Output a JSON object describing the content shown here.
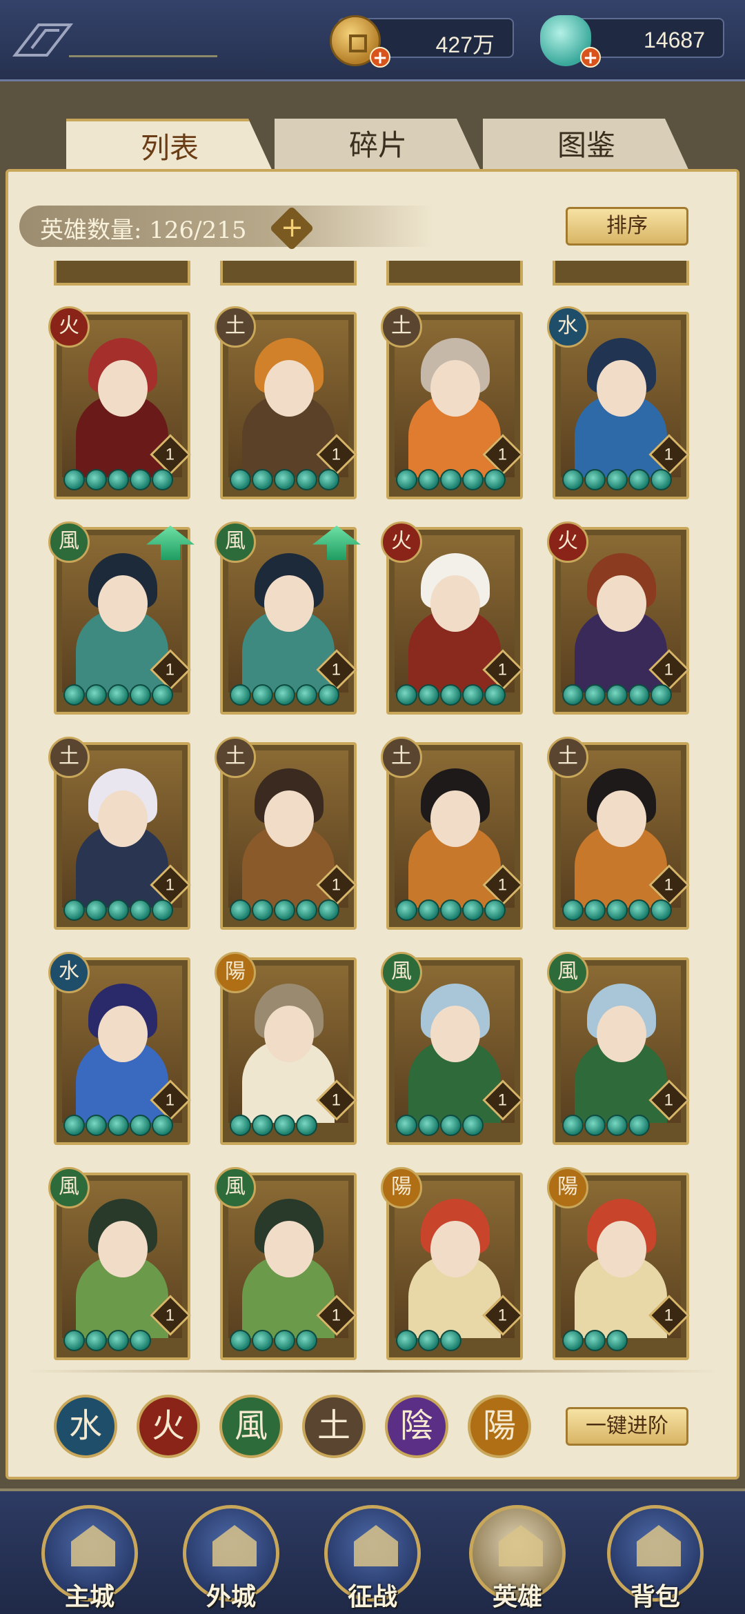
{
  "currency": {
    "coins_value": "427万",
    "gems_value": "14687",
    "coin_icon": "copper-coin-icon",
    "gem_icon": "jade-shell-icon"
  },
  "tabs": [
    {
      "label": "列表",
      "active": true
    },
    {
      "label": "碎片",
      "active": false
    },
    {
      "label": "图鉴",
      "active": false
    }
  ],
  "hero_count_label": "英雄数量: 126/215",
  "sort_label": "排序",
  "advance_all_label": "一键进阶",
  "elements": {
    "water": {
      "glyph": "水",
      "color": "#1f4e6b"
    },
    "fire": {
      "glyph": "火",
      "color": "#8a2418"
    },
    "wind": {
      "glyph": "風",
      "color": "#2e6b3a"
    },
    "earth": {
      "glyph": "土",
      "color": "#5a4630"
    },
    "yin": {
      "glyph": "陰",
      "color": "#5b2f86"
    },
    "yang": {
      "glyph": "陽",
      "color": "#b06f14"
    }
  },
  "heroes": [
    {
      "element": "fire",
      "level": "1",
      "stars": 5,
      "upgrade": false,
      "palette": [
        "#a5302b",
        "#6b1a1a"
      ]
    },
    {
      "element": "earth",
      "level": "1",
      "stars": 5,
      "upgrade": false,
      "palette": [
        "#d0812a",
        "#5a4128"
      ]
    },
    {
      "element": "earth",
      "level": "1",
      "stars": 5,
      "upgrade": false,
      "palette": [
        "#c6b8a8",
        "#e07c30"
      ]
    },
    {
      "element": "water",
      "level": "1",
      "stars": 5,
      "upgrade": false,
      "palette": [
        "#213552",
        "#2f6aa8"
      ]
    },
    {
      "element": "wind",
      "level": "1",
      "stars": 5,
      "upgrade": true,
      "palette": [
        "#1d2a3a",
        "#3f8a80"
      ]
    },
    {
      "element": "wind",
      "level": "1",
      "stars": 5,
      "upgrade": true,
      "palette": [
        "#1d2a3a",
        "#3f8a80"
      ]
    },
    {
      "element": "fire",
      "level": "1",
      "stars": 5,
      "upgrade": false,
      "palette": [
        "#f3f0ea",
        "#8a2a1e"
      ]
    },
    {
      "element": "fire",
      "level": "1",
      "stars": 5,
      "upgrade": false,
      "palette": [
        "#8a3b20",
        "#3a2a5a"
      ]
    },
    {
      "element": "earth",
      "level": "1",
      "stars": 5,
      "upgrade": false,
      "palette": [
        "#e9e6f0",
        "#2a3552"
      ]
    },
    {
      "element": "earth",
      "level": "1",
      "stars": 5,
      "upgrade": false,
      "palette": [
        "#3a2a20",
        "#8a5a2a"
      ]
    },
    {
      "element": "earth",
      "level": "1",
      "stars": 5,
      "upgrade": false,
      "palette": [
        "#1f1a1a",
        "#c8782a"
      ]
    },
    {
      "element": "earth",
      "level": "1",
      "stars": 5,
      "upgrade": false,
      "palette": [
        "#1f1a1a",
        "#c8782a"
      ]
    },
    {
      "element": "water",
      "level": "1",
      "stars": 5,
      "upgrade": false,
      "palette": [
        "#2a2a6a",
        "#3a6ac0"
      ]
    },
    {
      "element": "yang",
      "level": "1",
      "stars": 4,
      "upgrade": false,
      "palette": [
        "#9a8a70",
        "#efe6d0"
      ]
    },
    {
      "element": "wind",
      "level": "1",
      "stars": 4,
      "upgrade": false,
      "palette": [
        "#a8c6d8",
        "#2e6a3a"
      ]
    },
    {
      "element": "wind",
      "level": "1",
      "stars": 4,
      "upgrade": false,
      "palette": [
        "#a8c6d8",
        "#2e6a3a"
      ]
    },
    {
      "element": "wind",
      "level": "1",
      "stars": 4,
      "upgrade": false,
      "palette": [
        "#2a3a2a",
        "#6a9a4a"
      ]
    },
    {
      "element": "wind",
      "level": "1",
      "stars": 4,
      "upgrade": false,
      "palette": [
        "#2a3a2a",
        "#6a9a4a"
      ]
    },
    {
      "element": "yang",
      "level": "1",
      "stars": 3,
      "upgrade": false,
      "palette": [
        "#c8442a",
        "#e8d8a8"
      ]
    },
    {
      "element": "yang",
      "level": "1",
      "stars": 3,
      "upgrade": false,
      "palette": [
        "#c8442a",
        "#e8d8a8"
      ]
    }
  ],
  "filters": [
    {
      "element": "water",
      "name": "water-filter-button"
    },
    {
      "element": "fire",
      "name": "fire-filter-button"
    },
    {
      "element": "wind",
      "name": "wind-filter-button"
    },
    {
      "element": "earth",
      "name": "earth-filter-button"
    },
    {
      "element": "yin",
      "name": "yin-filter-button"
    },
    {
      "element": "yang",
      "name": "yang-filter-button"
    }
  ],
  "nav": [
    {
      "label": "主城",
      "icon": "main-city-icon",
      "active": false
    },
    {
      "label": "外城",
      "icon": "outer-city-icon",
      "active": false
    },
    {
      "label": "征战",
      "icon": "campaign-icon",
      "active": false
    },
    {
      "label": "英雄",
      "icon": "hero-icon",
      "active": true
    },
    {
      "label": "背包",
      "icon": "bag-icon",
      "active": false
    }
  ]
}
